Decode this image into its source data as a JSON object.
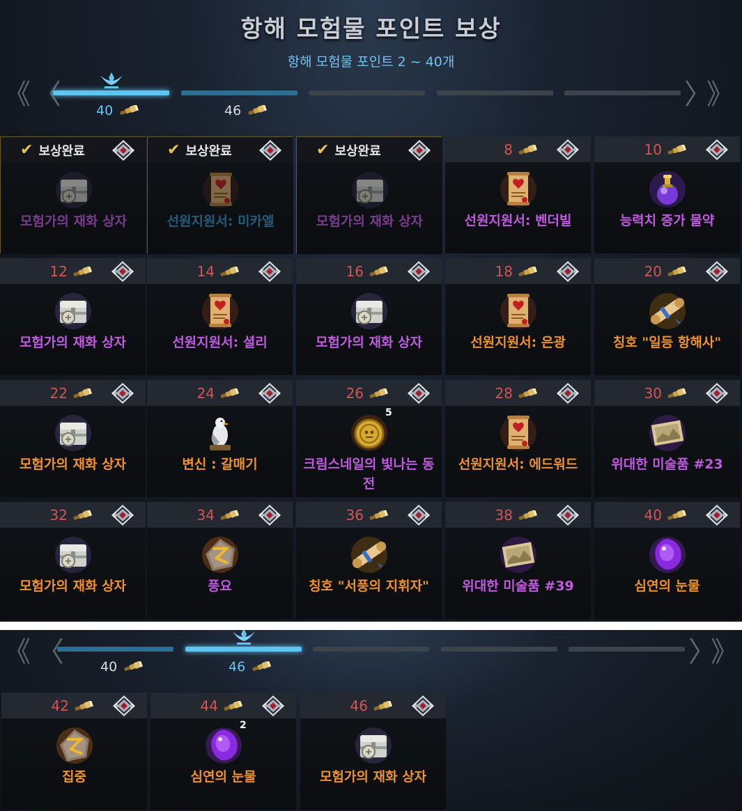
{
  "header": {
    "title": "항해 모험물 포인트 보상",
    "subtitle": "항해 모험물 포인트 2 ~ 40개"
  },
  "nav": {
    "prev_all": "《",
    "prev": "〈",
    "next": "〉",
    "next_all": "》"
  },
  "colors": {
    "epic": "#c05ae0",
    "legendary": "#f0922c",
    "rare": "#2f8fc4",
    "points": "#d65454",
    "active_progress": "#5fc4f2"
  },
  "view1": {
    "milestones": [
      {
        "label": "40",
        "state": "active"
      },
      {
        "label": "46",
        "state": "normal"
      }
    ],
    "rewards": [
      {
        "points": "",
        "done": true,
        "done_label": "보상완료",
        "name": "모험가의 재화 상자",
        "grade": "epic",
        "icon": "chest-icon"
      },
      {
        "points": "",
        "done": true,
        "done_label": "보상완료",
        "name": "선원지원서: 미카엘",
        "grade": "rare",
        "icon": "scroll-icon"
      },
      {
        "points": "",
        "done": true,
        "done_label": "보상완료",
        "name": "모험가의 재화 상자",
        "grade": "epic",
        "icon": "chest-icon"
      },
      {
        "points": "8",
        "done": false,
        "name": "선원지원서: 벤더빌",
        "grade": "epic",
        "icon": "scroll-icon"
      },
      {
        "points": "10",
        "done": false,
        "name": "능력치 증가 물약",
        "grade": "epic",
        "icon": "potion-icon"
      },
      {
        "points": "12",
        "done": false,
        "name": "모험가의 재화 상자",
        "grade": "epic",
        "icon": "chest-icon"
      },
      {
        "points": "14",
        "done": false,
        "name": "선원지원서: 셜리",
        "grade": "epic",
        "icon": "scroll-icon"
      },
      {
        "points": "16",
        "done": false,
        "name": "모험가의 재화 상자",
        "grade": "epic",
        "icon": "chest-icon"
      },
      {
        "points": "18",
        "done": false,
        "name": "선원지원서: 은광",
        "grade": "legendary",
        "icon": "scroll-icon"
      },
      {
        "points": "20",
        "done": false,
        "name": "칭호 \"일등 항해사\"",
        "grade": "legendary",
        "icon": "title-scroll-icon"
      },
      {
        "points": "22",
        "done": false,
        "name": "모험가의 재화 상자",
        "grade": "legendary",
        "icon": "chest-icon"
      },
      {
        "points": "24",
        "done": false,
        "name": "변신 : 갈매기",
        "grade": "legendary",
        "icon": "seagull-icon"
      },
      {
        "points": "26",
        "done": false,
        "name": "크림스네일의 빛나는 동전",
        "grade": "epic",
        "icon": "coin-icon",
        "qty": "5"
      },
      {
        "points": "28",
        "done": false,
        "name": "선원지원서: 에드워드",
        "grade": "legendary",
        "icon": "scroll-icon"
      },
      {
        "points": "30",
        "done": false,
        "name": "위대한 미술품 #23",
        "grade": "epic",
        "icon": "painting-icon"
      },
      {
        "points": "32",
        "done": false,
        "name": "모험가의 재화 상자",
        "grade": "legendary",
        "icon": "chest-icon"
      },
      {
        "points": "34",
        "done": false,
        "name": "풍요",
        "grade": "epic",
        "icon": "rune-icon"
      },
      {
        "points": "36",
        "done": false,
        "name": "칭호 \"서풍의 지휘자\"",
        "grade": "legendary",
        "icon": "title-scroll-icon"
      },
      {
        "points": "38",
        "done": false,
        "name": "위대한 미술품 #39",
        "grade": "epic",
        "icon": "painting-icon"
      },
      {
        "points": "40",
        "done": false,
        "name": "심연의 눈물",
        "grade": "legendary",
        "icon": "gem-icon"
      }
    ]
  },
  "view2": {
    "milestones": [
      {
        "label": "40",
        "state": "normal"
      },
      {
        "label": "46",
        "state": "active"
      }
    ],
    "rewards": [
      {
        "points": "42",
        "done": false,
        "name": "집중",
        "grade": "legendary",
        "icon": "rune-icon"
      },
      {
        "points": "44",
        "done": false,
        "name": "심연의 눈물",
        "grade": "legendary",
        "icon": "gem-icon",
        "qty": "2"
      },
      {
        "points": "46",
        "done": false,
        "name": "모험가의 재화 상자",
        "grade": "legendary",
        "icon": "chest-icon"
      }
    ]
  }
}
